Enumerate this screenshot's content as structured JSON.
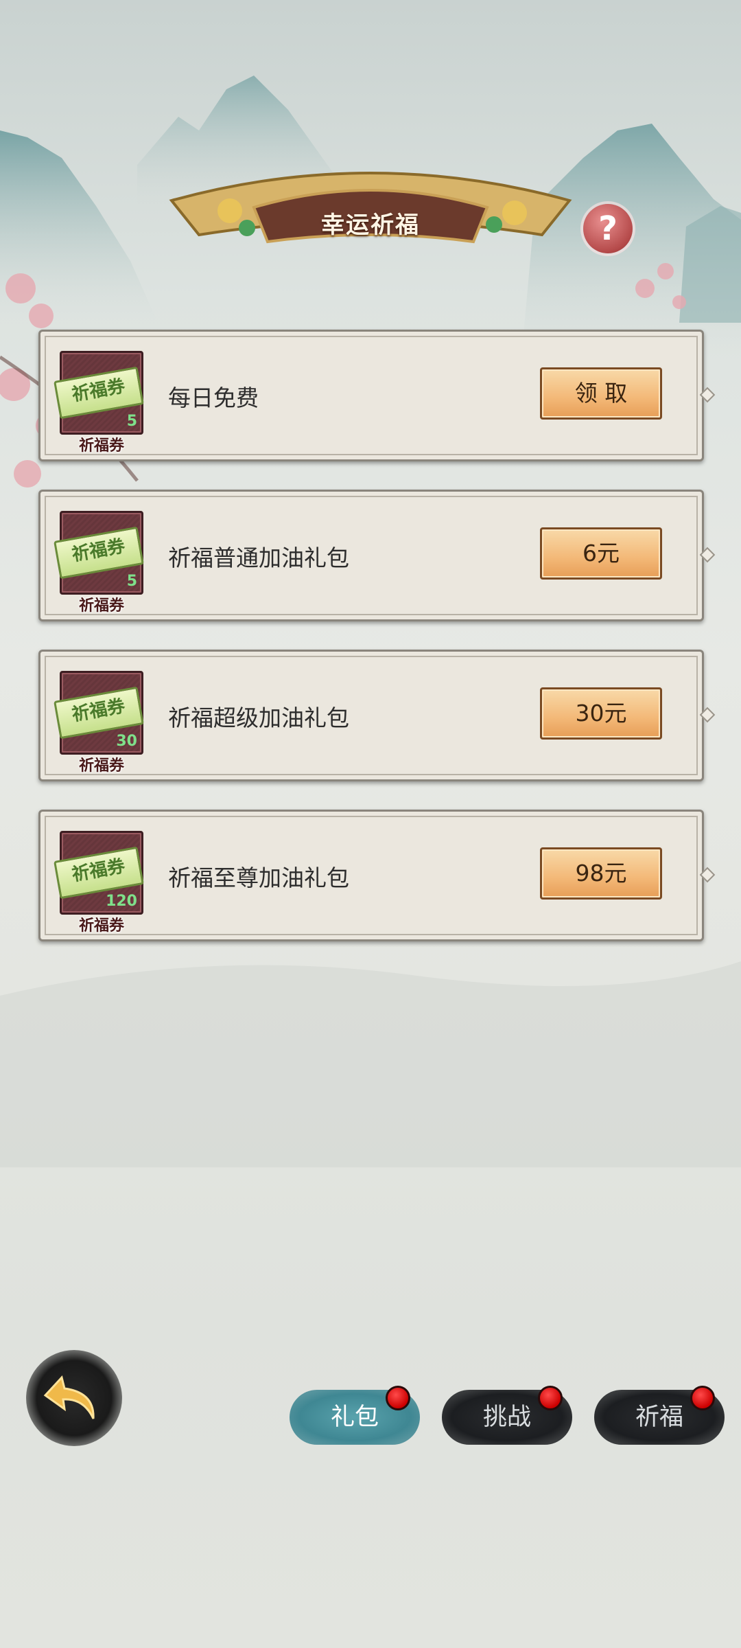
{
  "header": {
    "title": "幸运祈福",
    "help_icon": "question-icon"
  },
  "rewards": [
    {
      "title": "每日免费",
      "item_name": "祈福券",
      "ticket_text": "祈福券",
      "count": "5",
      "button": "领 取"
    },
    {
      "title": "祈福普通加油礼包",
      "item_name": "祈福券",
      "ticket_text": "祈福券",
      "count": "5",
      "button": "6元"
    },
    {
      "title": "祈福超级加油礼包",
      "item_name": "祈福券",
      "ticket_text": "祈福券",
      "count": "30",
      "button": "30元"
    },
    {
      "title": "祈福至尊加油礼包",
      "item_name": "祈福券",
      "ticket_text": "祈福券",
      "count": "120",
      "button": "98元"
    }
  ],
  "tabs": [
    {
      "label": "礼包",
      "active": true,
      "badge": true
    },
    {
      "label": "挑战",
      "active": false,
      "badge": true
    },
    {
      "label": "祈福",
      "active": false,
      "badge": true
    }
  ],
  "colors": {
    "accent_teal": "#3f8793",
    "button_orange": "#f3b877",
    "badge_red": "#cc0000",
    "ticket_green": "#c6e08c"
  }
}
